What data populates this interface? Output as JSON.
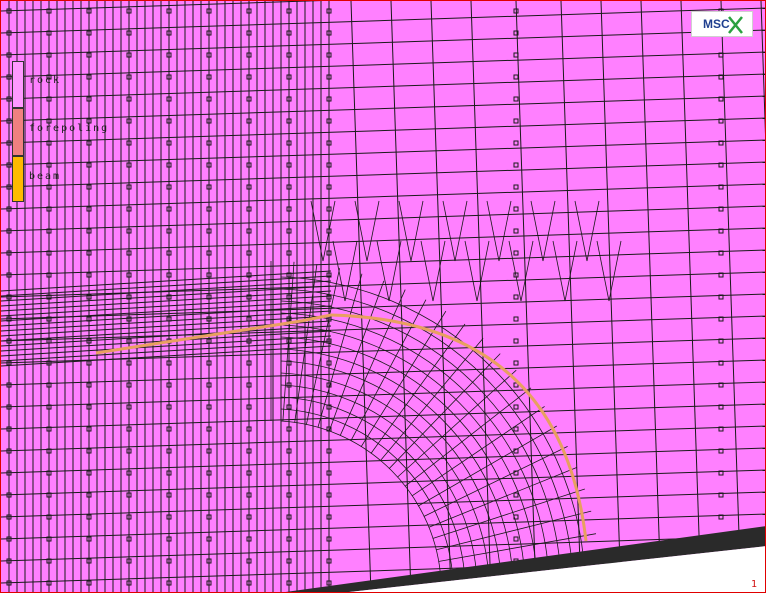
{
  "legend": {
    "items": [
      {
        "label": "rock",
        "color": "#ff99ff"
      },
      {
        "label": "forepoling",
        "color": "#f08080"
      },
      {
        "label": "beam",
        "color": "#ffbb00"
      }
    ]
  },
  "logo": {
    "text": "MSC"
  },
  "frame": {
    "number": "1"
  },
  "colors": {
    "background": "#ff80ff",
    "mesh_line": "#1a1a1a",
    "tunnel_lining": "#e8a060",
    "border": "#e00000"
  }
}
